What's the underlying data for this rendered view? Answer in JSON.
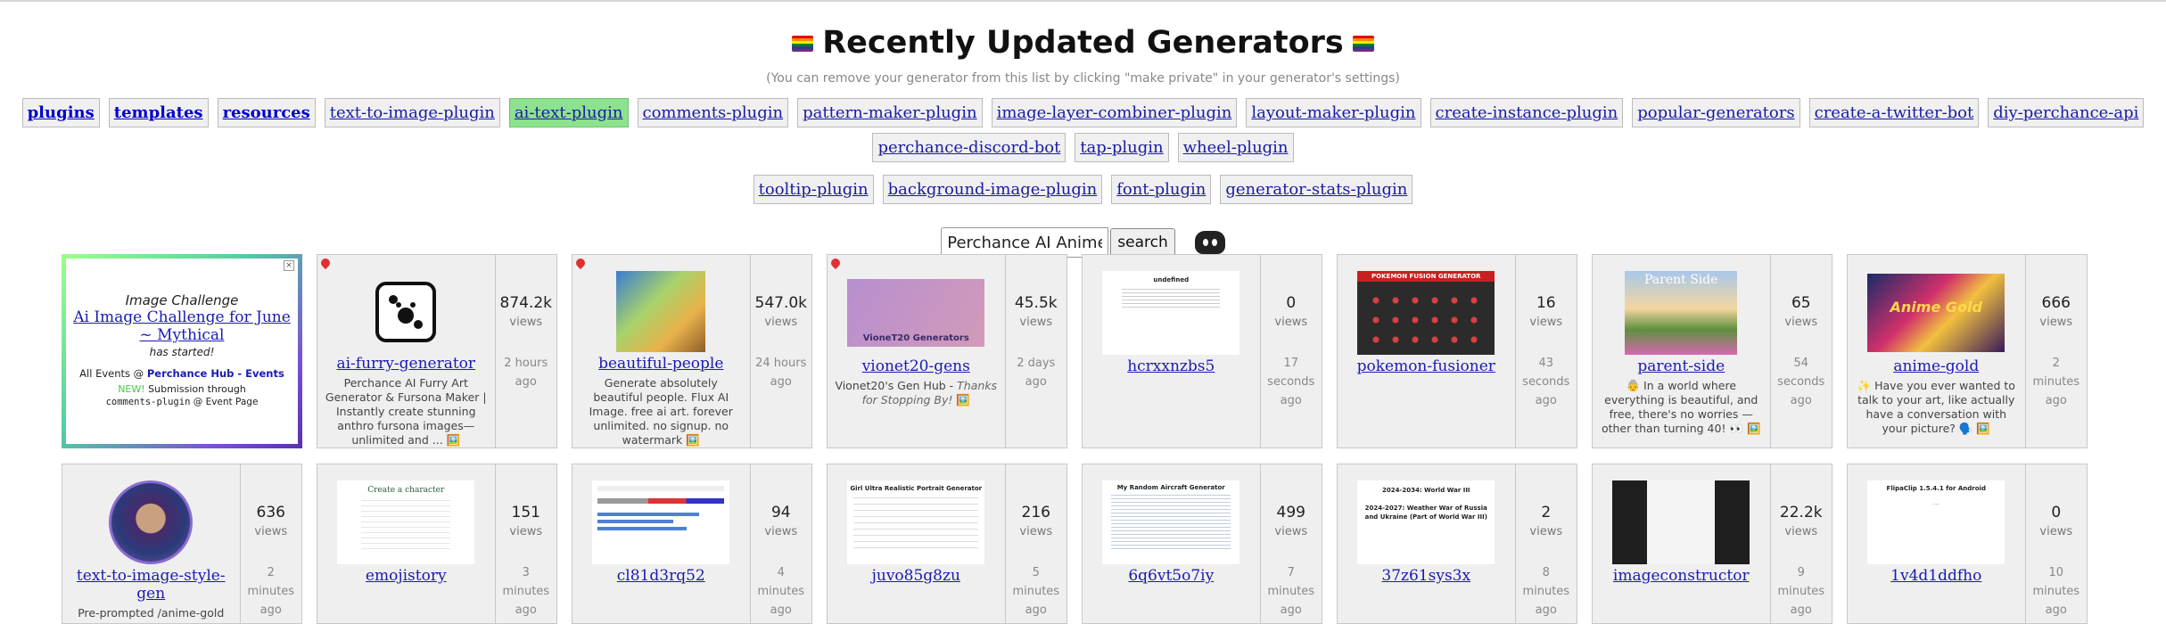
{
  "page": {
    "title": "Recently Updated Generators",
    "subtitle": "(You can remove your generator from this list by clicking \"make private\" in your generator's settings)"
  },
  "tags_row1": [
    "plugins",
    "templates",
    "resources",
    "text-to-image-plugin",
    "ai-text-plugin",
    "comments-plugin",
    "pattern-maker-plugin",
    "image-layer-combiner-plugin",
    "layout-maker-plugin",
    "create-instance-plugin",
    "popular-generators",
    "create-a-twitter-bot",
    "diy-perchance-api",
    "perchance-discord-bot",
    "tap-plugin",
    "wheel-plugin"
  ],
  "tags_row2": [
    "tooltip-plugin",
    "background-image-plugin",
    "font-plugin",
    "generator-stats-plugin"
  ],
  "search": {
    "value": "Perchance AI Anime Stu",
    "button": "search"
  },
  "challenge": {
    "title": "Image Challenge",
    "link": "Ai Image Challenge for June ~ Mythical",
    "sub": "has started!",
    "events_prefix": "All Events @ ",
    "events_link": "Perchance Hub - Events",
    "new_label": "NEW!",
    "new_text": " Submission through",
    "mono": "comments-plugin",
    "mono_suffix": " @ Event Page"
  },
  "row1": [
    {
      "name": "ai-furry-generator",
      "views": "874.2k",
      "views_label": "views",
      "ago": "2 hours ago",
      "desc": "Perchance AI Furry Art Generator & Fursona Maker | Instantly create stunning anthro fursona images—unlimited and ... 🖼️"
    },
    {
      "name": "beautiful-people",
      "views": "547.0k",
      "views_label": "views",
      "ago": "24 hours ago",
      "desc": "Generate absolutely beautiful people. Flux AI Image. free ai art. forever unlimited. no signup. no watermark 🖼️"
    },
    {
      "name": "vionet20-gens",
      "views": "45.5k",
      "views_label": "views",
      "ago": "2 days ago",
      "desc": "Vionet20's Gen Hub - ",
      "desc_italic": "Thanks for Stopping By!",
      "desc_tail": " 🖼️",
      "thumb_text": "VioneT20 Generators"
    },
    {
      "name": "hcrxxnzbs5",
      "views": "0",
      "views_label": "views",
      "ago": "17 seconds ago",
      "desc": "",
      "thumb_text": "undefined"
    },
    {
      "name": "pokemon-fusioner",
      "views": "16",
      "views_label": "views",
      "ago": "43 seconds ago",
      "desc": "",
      "thumb_text": "POKEMON FUSION GENERATOR"
    },
    {
      "name": "parent-side",
      "views": "65",
      "views_label": "views",
      "ago": "54 seconds ago",
      "desc": "👵 In a world where everything is beautiful, and free, there's no worries —other than turning 40! 👀 🖼️",
      "thumb_text": "Parent Side"
    },
    {
      "name": "anime-gold",
      "views": "666",
      "views_label": "views",
      "ago": "2 minutes ago",
      "desc": "✨ Have you ever wanted to talk to your art, like actually have a conversation with your picture? 🗣️ 🖼️",
      "thumb_text": "Anime Gold"
    }
  ],
  "row2": [
    {
      "name": "text-to-image-style-gen",
      "views": "636",
      "views_label": "views",
      "ago": "2 minutes ago",
      "desc": "Pre-prompted /anime-gold"
    },
    {
      "name": "emojistory",
      "views": "151",
      "views_label": "views",
      "ago": "3 minutes ago",
      "thumb_text": "Create a character"
    },
    {
      "name": "cl81d3rq52",
      "views": "94",
      "views_label": "views",
      "ago": "4 minutes ago"
    },
    {
      "name": "juvo85g8zu",
      "views": "216",
      "views_label": "views",
      "ago": "5 minutes ago",
      "thumb_text": "Girl Ultra Realistic Portrait Generator"
    },
    {
      "name": "6q6vt5o7iy",
      "views": "499",
      "views_label": "views",
      "ago": "7 minutes ago",
      "thumb_text": "My Random Aircraft Generator"
    },
    {
      "name": "37z61sys3x",
      "views": "2",
      "views_label": "views",
      "ago": "8 minutes ago",
      "thumb_text": "2024-2034: World War III"
    },
    {
      "name": "imageconstructor",
      "views": "22.2k",
      "views_label": "views",
      "ago": "9 minutes ago"
    },
    {
      "name": "1v4d1ddfho",
      "views": "0",
      "views_label": "views",
      "ago": "10 minutes ago",
      "thumb_text": "FlipaClip 1.5.4.1 for Android"
    }
  ]
}
